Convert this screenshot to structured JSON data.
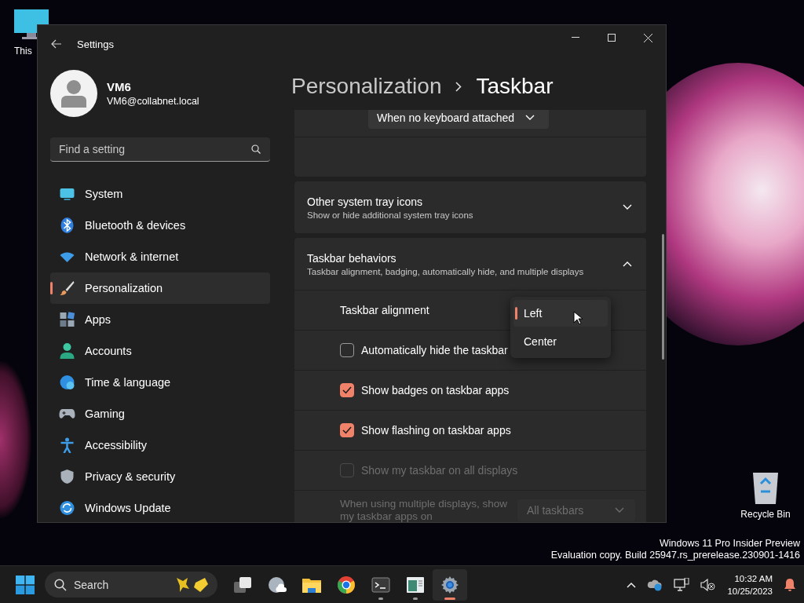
{
  "desktop": {
    "icons": [
      {
        "kind": "pc",
        "label": "This"
      },
      {
        "kind": "bin",
        "label": "Recycle Bin"
      }
    ],
    "build_info": [
      "Windows 11 Pro Insider Preview",
      "Evaluation copy. Build 25947.rs_prerelease.230901-1416"
    ]
  },
  "window": {
    "title": "Settings",
    "user": {
      "name": "VM6",
      "email": "VM6@collabnet.local"
    },
    "search": {
      "placeholder": "Find a setting"
    },
    "nav": [
      {
        "kind": "system",
        "label": "System",
        "selected": false
      },
      {
        "kind": "bluetooth",
        "label": "Bluetooth & devices",
        "selected": false
      },
      {
        "kind": "network",
        "label": "Network & internet",
        "selected": false
      },
      {
        "kind": "brush",
        "label": "Personalization",
        "selected": true
      },
      {
        "kind": "apps",
        "label": "Apps",
        "selected": false
      },
      {
        "kind": "accounts",
        "label": "Accounts",
        "selected": false
      },
      {
        "kind": "time",
        "label": "Time & language",
        "selected": false
      },
      {
        "kind": "gaming",
        "label": "Gaming",
        "selected": false
      },
      {
        "kind": "accessibility",
        "label": "Accessibility",
        "selected": false
      },
      {
        "kind": "privacy",
        "label": "Privacy & security",
        "selected": false
      },
      {
        "kind": "update",
        "label": "Windows Update",
        "selected": false
      }
    ],
    "breadcrumb": [
      "Personalization",
      "Taskbar"
    ],
    "top_dropdown": {
      "value": "When no keyboard attached"
    },
    "sections": [
      {
        "title": "Other system tray icons",
        "subtitle": "Show or hide additional system tray icons",
        "expanded": false
      },
      {
        "title": "Taskbar behaviors",
        "subtitle": "Taskbar alignment, badging, automatically hide, and multiple displays",
        "expanded": true
      }
    ],
    "rows": [
      {
        "kind": "dropdown",
        "label": "Taskbar alignment",
        "disabled": false
      },
      {
        "kind": "checkbox",
        "label": "Automatically hide the taskbar",
        "checked": false,
        "disabled": false
      },
      {
        "kind": "checkbox",
        "label": "Show badges on taskbar apps",
        "checked": true,
        "disabled": false
      },
      {
        "kind": "checkbox",
        "label": "Show flashing on taskbar apps",
        "checked": true,
        "disabled": false
      },
      {
        "kind": "checkbox",
        "label": "Show my taskbar on all displays",
        "checked": false,
        "disabled": true
      },
      {
        "kind": "dropdown",
        "label": "When using multiple displays, show my taskbar apps on",
        "value": "All taskbars",
        "disabled": true
      }
    ],
    "alignment_menu": [
      {
        "label": "Left",
        "selected": true
      },
      {
        "label": "Center",
        "selected": false
      }
    ]
  },
  "taskbar": {
    "search": {
      "placeholder": "Search"
    },
    "apps": [
      {
        "kind": "taskview",
        "running": false,
        "active": false
      },
      {
        "kind": "cloud",
        "running": false,
        "active": false
      },
      {
        "kind": "folder",
        "running": false,
        "active": false
      },
      {
        "kind": "browser",
        "running": false,
        "active": false
      },
      {
        "kind": "terminal",
        "running": true,
        "active": false
      },
      {
        "kind": "window",
        "running": true,
        "active": false
      },
      {
        "kind": "settings",
        "running": true,
        "active": true
      }
    ],
    "time": "10:32 AM",
    "date": "10/25/2023"
  }
}
